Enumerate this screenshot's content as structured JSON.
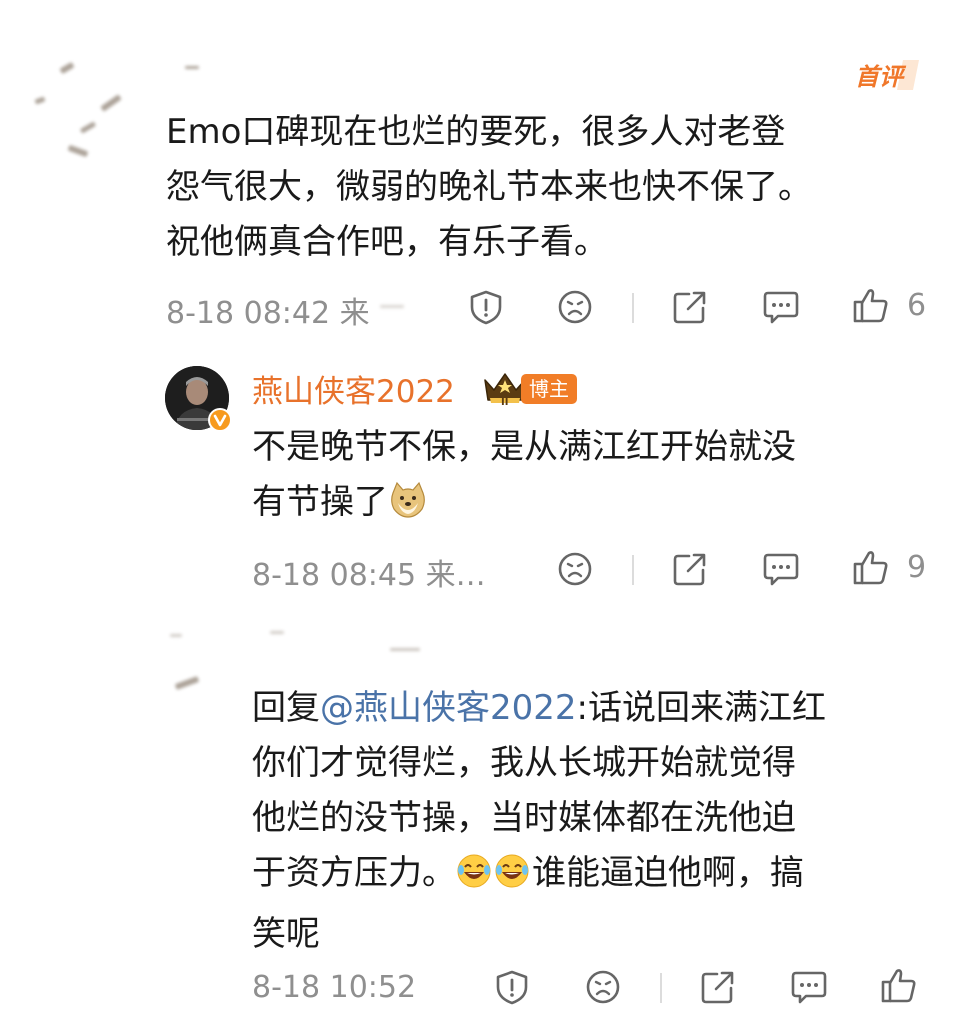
{
  "comment1": {
    "badge": "首评",
    "text_lines": [
      "Emo口碑现在也烂的要死，很多人对老登",
      "怨气很大，微弱的晚礼节本来也快不保了。",
      "祝他俩真合作吧，有乐子看。"
    ],
    "meta": "8-18 08:42 来",
    "like_count": "6"
  },
  "reply1": {
    "username": "燕山侠客2022",
    "author_tag": "博主",
    "rank_badge": "II",
    "text_lines": [
      "不是晚节不保，是从满江红开始就没",
      "有节操了"
    ],
    "meta": "8-18 08:45 来…",
    "like_count": "9"
  },
  "reply2": {
    "reply_prefix": "回复",
    "mention": "@燕山侠客2022",
    "line1_rest": ":话说回来满江红",
    "lines": [
      "你们才觉得烂，我从长城开始就觉得",
      "他烂的没节操，当时媒体都在洗他迫"
    ],
    "line4": "于资方压力。",
    "line4_rest": "谁能逼迫他啊，搞",
    "line5": "笑呢",
    "meta": "8-18 10:52"
  },
  "icons": [
    "report-icon",
    "dislike-icon",
    "share-icon",
    "comment-icon",
    "like-icon",
    "verified-icon",
    "crown-icon",
    "doge-emoji",
    "laugh-cry-emoji"
  ],
  "colors": {
    "username": "#e8722b",
    "mention": "#4a73a8",
    "meta": "#8f8f8f",
    "badge": "#f17d27"
  }
}
